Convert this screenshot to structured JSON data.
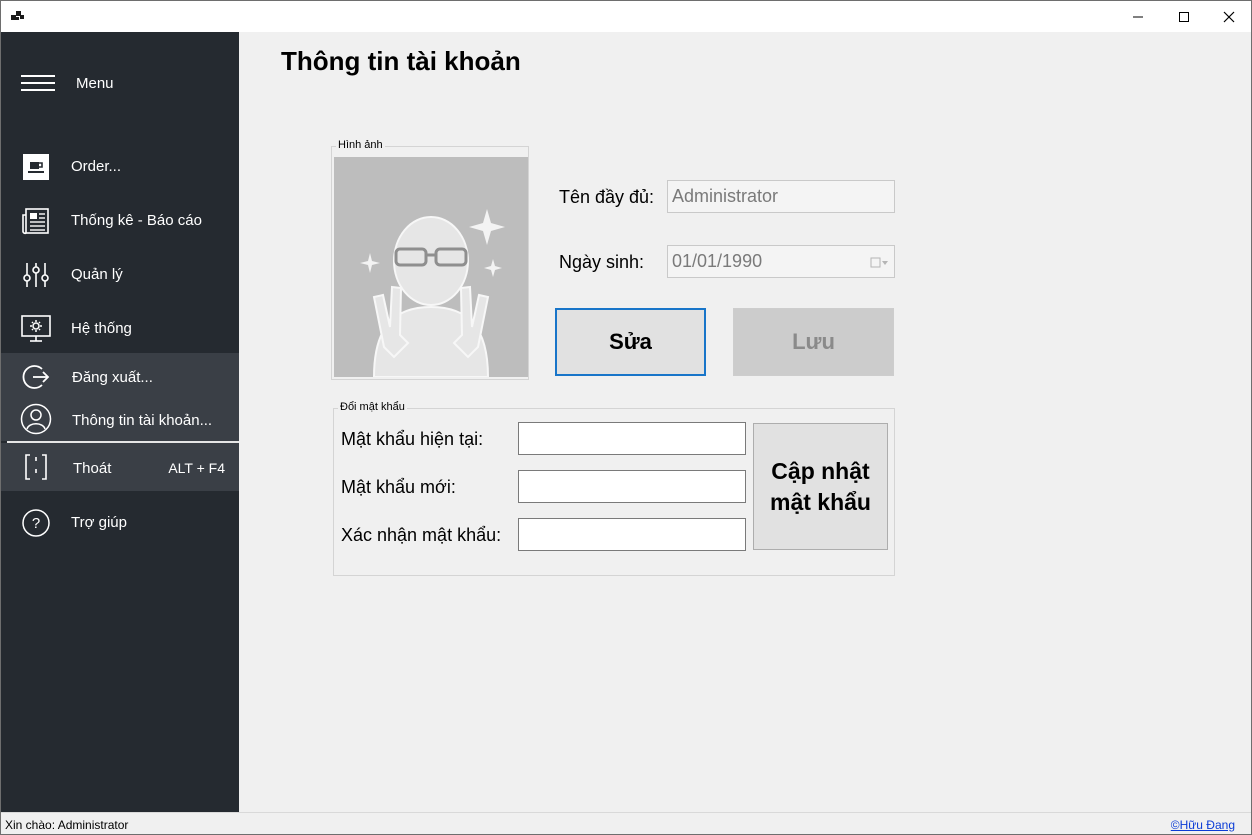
{
  "window": {
    "minimize_label": "–",
    "maximize_label": "☐",
    "close_label": "✕"
  },
  "sidebar": {
    "menu_label": "Menu",
    "items": [
      {
        "label": "Order...",
        "icon": "coffee-cup-icon"
      },
      {
        "label": "Thống kê - Báo cáo",
        "icon": "newspaper-icon"
      },
      {
        "label": "Quản lý",
        "icon": "sliders-icon"
      },
      {
        "label": "Hệ thống",
        "icon": "monitor-gear-icon"
      },
      {
        "label": "Đăng xuất...",
        "icon": "logout-icon"
      },
      {
        "label": "Thông tin tài khoản...",
        "icon": "user-circle-icon"
      },
      {
        "label": "Thoát",
        "icon": "exit-door-icon",
        "shortcut": "ALT + F4"
      },
      {
        "label": "Trợ giúp",
        "icon": "help-circle-icon"
      }
    ]
  },
  "main": {
    "title": "Thông tin tài khoản",
    "avatar_group_label": "Hình ảnh",
    "full_name_label": "Tên đầy đủ:",
    "full_name_value": "Administrator",
    "birthdate_label": "Ngày sinh:",
    "birthdate_value": "01/01/1990",
    "edit_button": "Sửa",
    "save_button": "Lưu",
    "password_group_label": "Đổi mật khẩu",
    "current_password_label": "Mật khẩu hiện tại:",
    "new_password_label": "Mật khẩu mới:",
    "confirm_password_label": "Xác nhận mật khẩu:",
    "update_button_line1": "Cập nhật",
    "update_button_line2": "mật khẩu"
  },
  "statusbar": {
    "greeting": "Xin chào: Administrator",
    "author": "©Hữu Đang"
  },
  "colors": {
    "sidebar_bg": "#252a30",
    "sidebar_highlight": "#3a3f46",
    "accent": "#1875c9",
    "link": "#0b3cd6"
  }
}
